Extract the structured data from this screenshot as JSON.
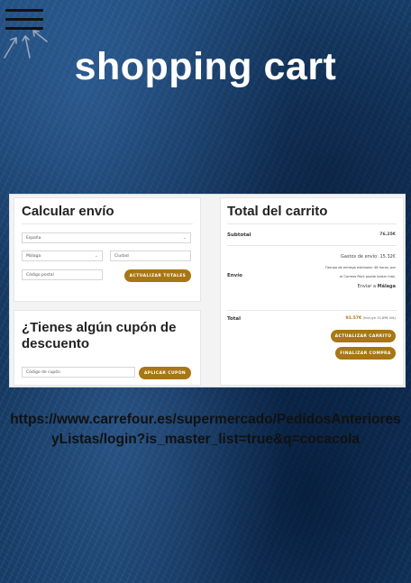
{
  "menu": {
    "icon": "hamburger-icon",
    "decoration": "arrow-marks-icon"
  },
  "header": {
    "title": "shopping cart"
  },
  "screenshot": {
    "shipping": {
      "heading": "Calcular envío",
      "country_value": "España",
      "province_value": "Málaga",
      "city_placeholder": "Ciudad",
      "postcode_placeholder": "Código postal",
      "update_button": "ACTUALIZAR TOTALES"
    },
    "coupon": {
      "heading": "¿Tienes algún cupón de descuento",
      "code_placeholder": "Código de cupón",
      "apply_button": "APLICAR CUPÓN"
    },
    "totals": {
      "heading": "Total del carrito",
      "subtotal_label": "Subtotal",
      "subtotal_value": "76.25€",
      "shipping_label": "Envío",
      "shipping_cost": "Gastos de envío: 15.32€",
      "shipping_note_1": "Tiempo de entrega estimado: 48 horas, por",
      "shipping_note_2": "el Correos Pack puede tardar más.",
      "ship_to_prefix": "Enviar a",
      "ship_to_city": "Málaga",
      "total_label": "Total",
      "total_value": "91.57€",
      "total_note": "(Incluye 15.89€ IVA)",
      "update_cart_button": "ACTUALIZAR CARRITO",
      "checkout_button": "FINALIZAR COMPRA"
    }
  },
  "link": {
    "url": "https://www.carrefour.es/supermercado/PedidosAnterioresyListas/login?is_master_list=true&q=cocacola"
  },
  "colors": {
    "accent": "#a87614",
    "background": "#123a66",
    "title_text": "#ffffff",
    "url_text": "#111111"
  }
}
